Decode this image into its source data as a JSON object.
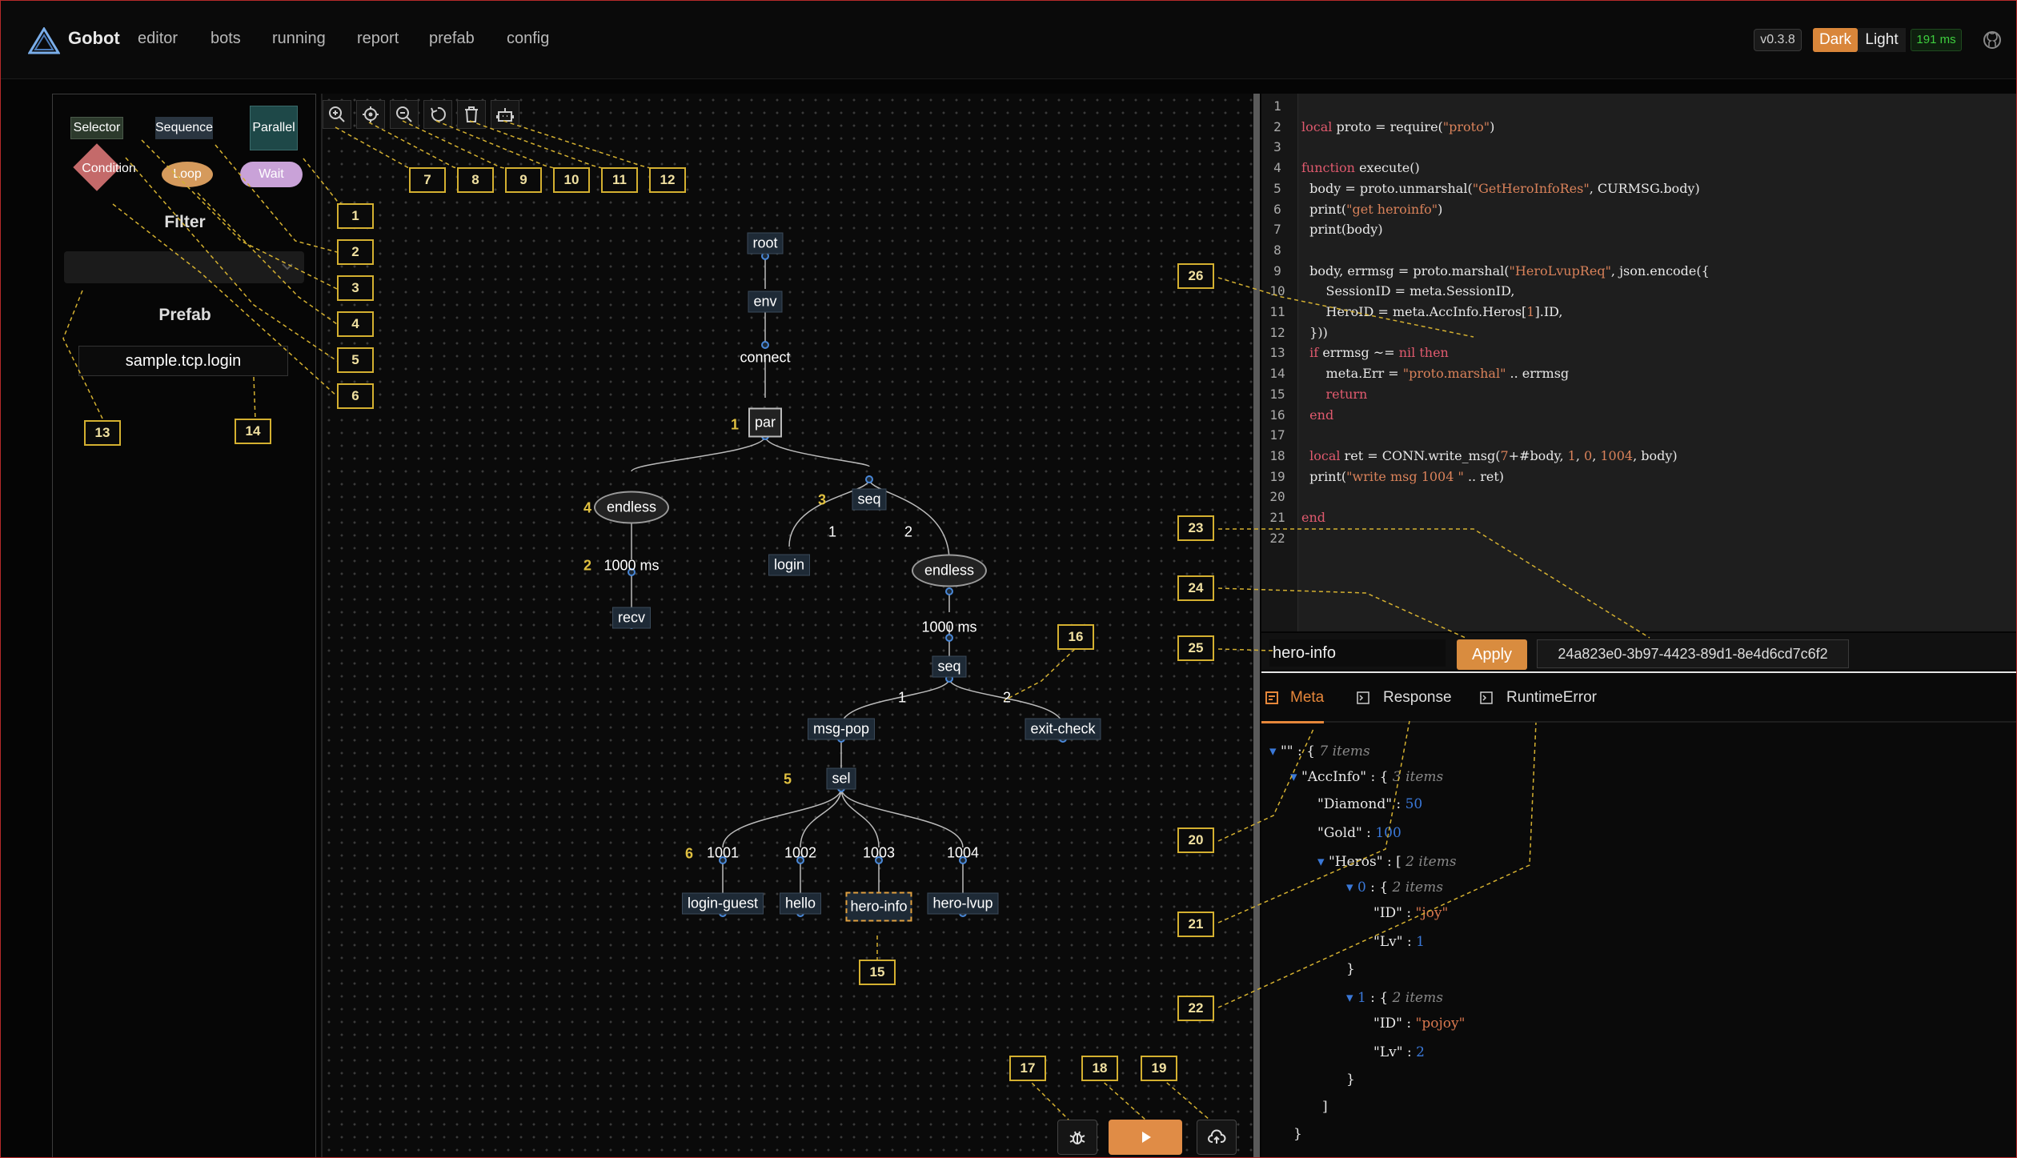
{
  "header": {
    "brand": "Gobot",
    "nav": [
      "editor",
      "bots",
      "running",
      "report",
      "prefab",
      "config"
    ],
    "version": "v0.3.8",
    "theme_dark": "Dark",
    "theme_light": "Light",
    "latency": "191 ms"
  },
  "palette": {
    "selector": "Selector",
    "sequence": "Sequence",
    "parallel": "Parallel",
    "condition": "Condition",
    "loop": "Loop",
    "wait": "Wait"
  },
  "left": {
    "filter_title": "Filter",
    "prefab_title": "Prefab",
    "prefab_item": "sample.tcp.login"
  },
  "tree": {
    "nodes": {
      "root": "root",
      "env": "env",
      "connect": "connect",
      "par": "par",
      "endless1": "endless",
      "seq1": "seq",
      "wait1": "1000 ms",
      "login": "login",
      "endless2": "endless",
      "recv": "recv",
      "wait2": "1000 ms",
      "seq2": "seq",
      "msgpop": "msg-pop",
      "exitcheck": "exit-check",
      "sel": "sel",
      "c1001": "1001",
      "c1002": "1002",
      "c1003": "1003",
      "c1004": "1004",
      "loginguest": "login-guest",
      "hello": "hello",
      "heroinfo": "hero-info",
      "herolvup": "hero-lvup"
    },
    "indexes": {
      "i1": "1",
      "i2": "2",
      "i3": "3",
      "i4": "4",
      "i5": "5",
      "i6": "6"
    },
    "edges": {
      "e1": "1",
      "e2": "2",
      "e3": "1",
      "e4": "2"
    }
  },
  "editor": {
    "lines": [
      "",
      "local proto = require(\"proto\")",
      "",
      "function execute()",
      "  body = proto.unmarshal(\"GetHeroInfoRes\", CURMSG.body)",
      "  print(\"get heroinfo\")",
      "  print(body)",
      "",
      "  body, errmsg = proto.marshal(\"HeroLvupReq\", json.encode({",
      "      SessionID = meta.SessionID,",
      "      HeroID = meta.AccInfo.Heros[1].ID,",
      "  }))",
      "  if errmsg ~= nil then",
      "      meta.Err = \"proto.marshal\" .. errmsg",
      "      return",
      "  end",
      "",
      "  local ret = CONN.write_msg(7+#body, 1, 0, 1004, body)",
      "  print(\"write msg 1004 \" .. ret)",
      "",
      "end",
      ""
    ]
  },
  "apply": {
    "node_name": "hero-info",
    "apply_label": "Apply",
    "uuid": "24a823e0-3b97-4423-89d1-8e4d6cd7c6f2"
  },
  "tabs": {
    "meta": "Meta",
    "response": "Response",
    "runtime": "RuntimeError"
  },
  "json": {
    "root_key": "\"\"",
    "root_count": "7 items",
    "accinfo": "\"AccInfo\"",
    "accinfo_count": "3 items",
    "diamond": "\"Diamond\"",
    "diamond_v": "50",
    "gold": "\"Gold\"",
    "gold_v": "100",
    "heros": "\"Heros\"",
    "heros_count": "2 items",
    "i0": "0",
    "i0_count": "2 items",
    "id0": "\"ID\"",
    "id0_v": "\"joy\"",
    "lv0": "\"Lv\"",
    "lv0_v": "1",
    "i1": "1",
    "i1_count": "2 items",
    "id1": "\"ID\"",
    "id1_v": "\"pojoy\"",
    "lv1": "\"Lv\"",
    "lv1_v": "2"
  },
  "callouts": [
    "1",
    "2",
    "3",
    "4",
    "5",
    "6",
    "7",
    "8",
    "9",
    "10",
    "11",
    "12",
    "13",
    "14",
    "15",
    "16",
    "17",
    "18",
    "19",
    "20",
    "21",
    "22",
    "23",
    "24",
    "25",
    "26"
  ],
  "icons": {
    "zoom_in": "zoom-in-icon",
    "center": "crosshair-icon",
    "zoom_out": "zoom-out-icon",
    "undo": "undo-icon",
    "delete": "trash-icon",
    "bot": "bot-icon",
    "debug": "bug-icon",
    "run": "play-icon",
    "upload": "cloud-upload-icon"
  },
  "colors": {
    "accent": "#e6873a",
    "callout": "#d4b030"
  }
}
